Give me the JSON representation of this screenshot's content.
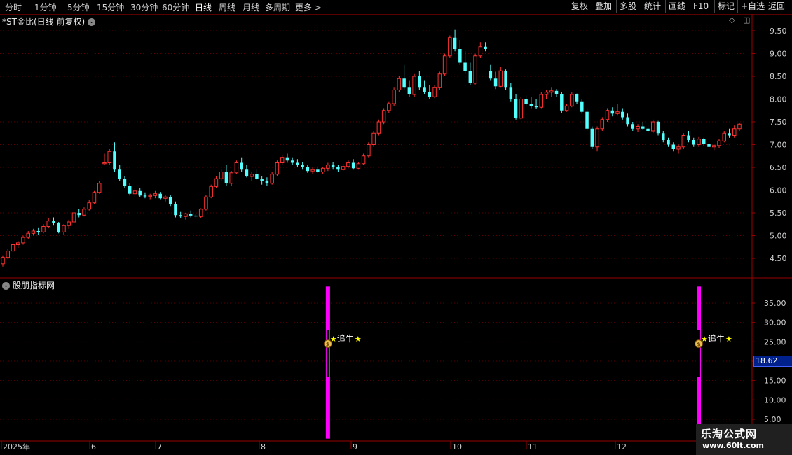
{
  "toolbar": {
    "periods": [
      "分时",
      "1分钟",
      "5分钟",
      "15分钟",
      "30分钟",
      "60分钟",
      "日线",
      "周线",
      "月线",
      "多周期",
      "更多 >"
    ],
    "active_period": "日线",
    "buttons": [
      "复权",
      "叠加",
      "多股",
      "统计",
      "画线",
      "F10",
      "+自选",
      "返回"
    ],
    "tag_button": "标记"
  },
  "main_title": "*ST金比(日线 前复权)",
  "indicator_title": "股朋指标网",
  "price_axis": [
    "9.50",
    "9.00",
    "8.50",
    "8.00",
    "7.50",
    "7.00",
    "6.50",
    "6.00",
    "5.50",
    "5.00",
    "4.50"
  ],
  "indicator_axis": [
    "35.00",
    "30.00",
    "25.00",
    "20.00",
    "15.00",
    "10.00",
    "5.00"
  ],
  "indicator_value": "18.62",
  "date_axis": [
    "2025年",
    "6",
    "7",
    "8",
    "9",
    "10",
    "11",
    "12"
  ],
  "signal_label": "追牛",
  "colors": {
    "up": "#ff3232",
    "down": "#54ffff",
    "grid": "#5a0000",
    "signal_bar": "#ff00ff",
    "signal_text": "#ffff00"
  },
  "watermark": {
    "line1": "乐淘公式网",
    "line2": "www.60lt.com"
  },
  "chart_data": {
    "type": "candlestick",
    "price_range": [
      4.2,
      9.6
    ],
    "indicator_range": [
      0,
      40
    ],
    "signal_indices": [
      64,
      137,
      191
    ],
    "candles": [
      [
        4.38,
        4.55,
        4.32,
        4.52
      ],
      [
        4.52,
        4.7,
        4.48,
        4.66
      ],
      [
        4.66,
        4.85,
        4.62,
        4.8
      ],
      [
        4.8,
        4.88,
        4.72,
        4.84
      ],
      [
        4.84,
        5.0,
        4.8,
        4.96
      ],
      [
        4.96,
        5.1,
        4.92,
        5.05
      ],
      [
        5.05,
        5.15,
        5.0,
        5.1
      ],
      [
        5.1,
        5.18,
        5.02,
        5.08
      ],
      [
        5.08,
        5.25,
        5.05,
        5.2
      ],
      [
        5.2,
        5.38,
        5.16,
        5.32
      ],
      [
        5.32,
        5.4,
        5.22,
        5.28
      ],
      [
        5.28,
        5.3,
        5.05,
        5.08
      ],
      [
        5.08,
        5.25,
        5.02,
        5.22
      ],
      [
        5.22,
        5.35,
        5.15,
        5.3
      ],
      [
        5.3,
        5.55,
        5.28,
        5.5
      ],
      [
        5.5,
        5.58,
        5.4,
        5.45
      ],
      [
        5.45,
        5.62,
        5.42,
        5.58
      ],
      [
        5.58,
        5.78,
        5.55,
        5.72
      ],
      [
        5.72,
        5.98,
        5.7,
        5.95
      ],
      [
        5.95,
        6.2,
        5.92,
        6.15
      ],
      [
        6.58,
        6.8,
        6.55,
        6.6
      ],
      [
        6.6,
        6.9,
        6.55,
        6.85
      ],
      [
        6.85,
        7.05,
        6.4,
        6.45
      ],
      [
        6.45,
        6.55,
        6.2,
        6.25
      ],
      [
        6.25,
        6.3,
        6.05,
        6.1
      ],
      [
        6.1,
        6.15,
        5.88,
        5.92
      ],
      [
        5.92,
        6.05,
        5.85,
        5.98
      ],
      [
        5.98,
        6.05,
        5.85,
        5.88
      ],
      [
        5.88,
        5.95,
        5.82,
        5.86
      ],
      [
        5.86,
        5.92,
        5.8,
        5.88
      ],
      [
        5.88,
        5.98,
        5.82,
        5.92
      ],
      [
        5.92,
        5.96,
        5.8,
        5.82
      ],
      [
        5.82,
        5.9,
        5.75,
        5.85
      ],
      [
        5.85,
        5.9,
        5.65,
        5.7
      ],
      [
        5.7,
        5.75,
        5.4,
        5.45
      ],
      [
        5.45,
        5.52,
        5.38,
        5.42
      ],
      [
        5.42,
        5.5,
        5.35,
        5.48
      ],
      [
        5.48,
        5.55,
        5.4,
        5.44
      ],
      [
        5.44,
        5.48,
        5.4,
        5.42
      ],
      [
        5.42,
        5.6,
        5.38,
        5.58
      ],
      [
        5.58,
        5.9,
        5.55,
        5.85
      ],
      [
        5.85,
        6.12,
        5.82,
        6.08
      ],
      [
        6.08,
        6.3,
        6.05,
        6.25
      ],
      [
        6.25,
        6.45,
        6.2,
        6.4
      ],
      [
        6.4,
        6.55,
        6.1,
        6.15
      ],
      [
        6.15,
        6.42,
        6.1,
        6.38
      ],
      [
        6.38,
        6.65,
        6.35,
        6.6
      ],
      [
        6.6,
        6.72,
        6.4,
        6.45
      ],
      [
        6.45,
        6.55,
        6.28,
        6.3
      ],
      [
        6.3,
        6.4,
        6.2,
        6.35
      ],
      [
        6.35,
        6.45,
        6.22,
        6.25
      ],
      [
        6.25,
        6.3,
        6.12,
        6.2
      ],
      [
        6.2,
        6.28,
        6.1,
        6.15
      ],
      [
        6.15,
        6.4,
        6.12,
        6.35
      ],
      [
        6.35,
        6.65,
        6.3,
        6.6
      ],
      [
        6.6,
        6.78,
        6.55,
        6.72
      ],
      [
        6.72,
        6.8,
        6.6,
        6.65
      ],
      [
        6.65,
        6.72,
        6.55,
        6.6
      ],
      [
        6.6,
        6.68,
        6.5,
        6.55
      ],
      [
        6.55,
        6.62,
        6.45,
        6.5
      ],
      [
        6.5,
        6.55,
        6.38,
        6.42
      ],
      [
        6.42,
        6.5,
        6.35,
        6.45
      ],
      [
        6.45,
        6.52,
        6.38,
        6.4
      ],
      [
        6.4,
        6.5,
        6.35,
        6.48
      ],
      [
        6.48,
        6.6,
        6.42,
        6.55
      ],
      [
        6.55,
        6.62,
        6.45,
        6.5
      ],
      [
        6.5,
        6.55,
        6.4,
        6.45
      ],
      [
        6.45,
        6.58,
        6.42,
        6.52
      ],
      [
        6.52,
        6.65,
        6.48,
        6.6
      ],
      [
        6.6,
        6.68,
        6.45,
        6.48
      ],
      [
        6.48,
        6.62,
        6.45,
        6.58
      ],
      [
        6.58,
        6.8,
        6.55,
        6.75
      ],
      [
        6.75,
        7.05,
        6.72,
        7.0
      ],
      [
        7.0,
        7.3,
        6.95,
        7.25
      ],
      [
        7.25,
        7.55,
        7.2,
        7.5
      ],
      [
        7.5,
        7.8,
        7.45,
        7.75
      ],
      [
        7.75,
        7.95,
        7.7,
        7.9
      ],
      [
        7.9,
        8.25,
        7.85,
        8.2
      ],
      [
        8.2,
        8.5,
        8.15,
        8.45
      ],
      [
        8.45,
        8.75,
        8.2,
        8.25
      ],
      [
        8.25,
        8.4,
        8.05,
        8.1
      ],
      [
        8.1,
        8.55,
        8.05,
        8.5
      ],
      [
        8.5,
        8.62,
        8.2,
        8.25
      ],
      [
        8.25,
        8.4,
        8.1,
        8.15
      ],
      [
        8.15,
        8.3,
        8.0,
        8.05
      ],
      [
        8.05,
        8.3,
        8.02,
        8.25
      ],
      [
        8.25,
        8.6,
        8.2,
        8.55
      ],
      [
        8.55,
        9.0,
        8.5,
        8.95
      ],
      [
        8.95,
        9.4,
        8.9,
        9.35
      ],
      [
        9.35,
        9.52,
        9.05,
        9.1
      ],
      [
        9.1,
        9.3,
        8.75,
        8.8
      ],
      [
        8.8,
        9.05,
        8.55,
        8.62
      ],
      [
        8.62,
        8.8,
        8.3,
        8.35
      ],
      [
        8.35,
        9.0,
        8.32,
        8.95
      ],
      [
        8.95,
        9.25,
        8.9,
        9.15
      ],
      [
        9.15,
        9.25,
        9.05,
        9.1
      ],
      [
        8.62,
        8.75,
        8.4,
        8.45
      ],
      [
        8.45,
        8.6,
        8.22,
        8.28
      ],
      [
        8.28,
        8.7,
        8.25,
        8.62
      ],
      [
        8.62,
        8.65,
        8.2,
        8.25
      ],
      [
        8.25,
        8.35,
        7.95,
        8.0
      ],
      [
        8.0,
        8.1,
        7.55,
        7.58
      ],
      [
        7.58,
        8.05,
        7.55,
        8.0
      ],
      [
        8.0,
        8.08,
        7.85,
        7.9
      ],
      [
        7.9,
        8.05,
        7.8,
        7.85
      ],
      [
        7.85,
        8.0,
        7.78,
        7.82
      ],
      [
        7.82,
        8.15,
        7.8,
        8.1
      ],
      [
        8.1,
        8.2,
        8.0,
        8.15
      ],
      [
        8.15,
        8.25,
        8.05,
        8.18
      ],
      [
        8.18,
        8.22,
        8.05,
        8.1
      ],
      [
        8.1,
        8.15,
        7.7,
        7.75
      ],
      [
        7.75,
        7.9,
        7.72,
        7.85
      ],
      [
        7.85,
        8.15,
        7.82,
        8.1
      ],
      [
        8.1,
        8.12,
        7.9,
        7.95
      ],
      [
        7.95,
        8.0,
        7.68,
        7.72
      ],
      [
        7.72,
        7.8,
        7.3,
        7.35
      ],
      [
        7.35,
        7.4,
        6.9,
        6.95
      ],
      [
        6.95,
        7.4,
        6.85,
        7.35
      ],
      [
        7.35,
        7.6,
        7.3,
        7.55
      ],
      [
        7.55,
        7.8,
        7.5,
        7.75
      ],
      [
        7.75,
        7.82,
        7.62,
        7.68
      ],
      [
        7.68,
        7.9,
        7.65,
        7.72
      ],
      [
        7.72,
        7.8,
        7.55,
        7.6
      ],
      [
        7.6,
        7.68,
        7.4,
        7.45
      ],
      [
        7.45,
        7.5,
        7.3,
        7.35
      ],
      [
        7.35,
        7.45,
        7.28,
        7.4
      ],
      [
        7.4,
        7.5,
        7.32,
        7.35
      ],
      [
        7.35,
        7.42,
        7.25,
        7.3
      ],
      [
        7.3,
        7.55,
        7.25,
        7.5
      ],
      [
        7.5,
        7.52,
        7.2,
        7.25
      ],
      [
        7.25,
        7.3,
        7.05,
        7.1
      ],
      [
        7.1,
        7.15,
        6.95,
        7.0
      ],
      [
        7.0,
        7.05,
        6.85,
        6.9
      ],
      [
        6.9,
        7.0,
        6.8,
        6.95
      ],
      [
        6.95,
        7.25,
        6.9,
        7.2
      ],
      [
        7.2,
        7.3,
        7.05,
        7.1
      ],
      [
        7.1,
        7.15,
        6.95,
        7.0
      ],
      [
        7.0,
        7.18,
        6.95,
        7.12
      ],
      [
        7.12,
        7.15,
        6.98,
        7.02
      ],
      [
        7.02,
        7.08,
        6.9,
        6.95
      ],
      [
        6.95,
        7.02,
        6.88,
        6.98
      ],
      [
        6.98,
        7.12,
        6.92,
        7.08
      ],
      [
        7.08,
        7.3,
        7.05,
        7.25
      ],
      [
        7.25,
        7.35,
        7.15,
        7.2
      ],
      [
        7.2,
        7.42,
        7.15,
        7.35
      ],
      [
        7.35,
        7.48,
        7.3,
        7.45
      ]
    ]
  }
}
